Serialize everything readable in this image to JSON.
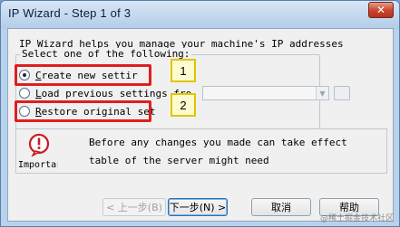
{
  "window": {
    "title": "IP Wizard - Step 1 of 3",
    "close_label": "✕"
  },
  "intro_text": "IP Wizard helps you manage your machine's IP addresses",
  "options_group": {
    "title": "Select one of the following:",
    "options": [
      {
        "label": "Create new settir",
        "underline_char": "C",
        "checked": true
      },
      {
        "label": "Load previous settings fro",
        "underline_char": "L",
        "checked": false
      },
      {
        "label": "Restore original set",
        "underline_char": "R",
        "checked": false
      }
    ]
  },
  "callouts": [
    "1",
    "2"
  ],
  "info": {
    "icon_label": "Importar",
    "line1": "Before any changes you made can take effect",
    "line2": "table of the server might need"
  },
  "buttons": {
    "back": "< 上一步(B)",
    "next": "下一步(N) >",
    "cancel": "取消",
    "help": "帮助"
  },
  "watermark": "@稀土掘金技术社区",
  "colors": {
    "highlight": "#e01e1e",
    "callout_bg": "#fffbd0",
    "callout_border": "#e3c400"
  }
}
